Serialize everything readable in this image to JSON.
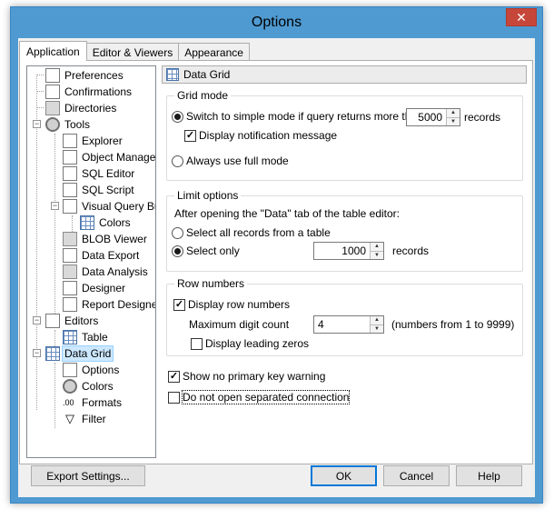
{
  "window": {
    "title": "Options",
    "close_glyph": "✕"
  },
  "tabs": [
    {
      "label": "Application",
      "active": true
    },
    {
      "label": "Editor & Viewers",
      "active": false
    },
    {
      "label": "Appearance",
      "active": false
    }
  ],
  "tree": {
    "items": [
      {
        "label": "Preferences",
        "icon": "preferences-icon"
      },
      {
        "label": "Confirmations",
        "icon": "confirmations-icon"
      },
      {
        "label": "Directories",
        "icon": "directories-icon"
      },
      {
        "label": "Tools",
        "icon": "tools-icon"
      },
      {
        "label": "Explorer",
        "icon": "explorer-icon"
      },
      {
        "label": "Object Manager",
        "icon": "object-manager-icon"
      },
      {
        "label": "SQL Editor",
        "icon": "sql-editor-icon"
      },
      {
        "label": "SQL Script",
        "icon": "sql-script-icon"
      },
      {
        "label": "Visual Query Builder",
        "icon": "visual-query-builder-icon"
      },
      {
        "label": "Colors",
        "icon": "colors-icon"
      },
      {
        "label": "BLOB Viewer",
        "icon": "blob-viewer-icon"
      },
      {
        "label": "Data Export",
        "icon": "data-export-icon"
      },
      {
        "label": "Data Analysis",
        "icon": "data-analysis-icon"
      },
      {
        "label": "Designer",
        "icon": "designer-icon"
      },
      {
        "label": "Report Designer",
        "icon": "report-designer-icon"
      },
      {
        "label": "Editors",
        "icon": "editors-icon"
      },
      {
        "label": "Table",
        "icon": "table-icon"
      },
      {
        "label": "Data Grid",
        "icon": "data-grid-icon",
        "selected": true
      },
      {
        "label": "Options",
        "icon": "options-icon"
      },
      {
        "label": "Colors",
        "icon": "grid-colors-icon"
      },
      {
        "label": "Formats",
        "icon": "formats-icon"
      },
      {
        "label": "Filter",
        "icon": "filter-icon"
      }
    ]
  },
  "panel": {
    "title": "Data Grid",
    "grid_mode": {
      "title": "Grid mode",
      "simple_mode_label": "Switch to simple mode if query returns more than",
      "simple_mode_value": "5000",
      "records_label": "records",
      "notify_label": "Display notification message",
      "full_mode_label": "Always use full mode"
    },
    "limit_options": {
      "title": "Limit options",
      "description": "After opening the \"Data\" tab of the table editor:",
      "select_all_label": "Select all records from a table",
      "select_only_label": "Select only",
      "select_only_value": "1000",
      "records_label": "records"
    },
    "row_numbers": {
      "title": "Row numbers",
      "display_label": "Display row numbers",
      "max_digit_label": "Maximum digit count",
      "max_digit_value": "4",
      "range_hint": "(numbers from 1 to 9999)",
      "leading_zeros_label": "Display leading zeros"
    },
    "no_pk_warning_label": "Show no primary key warning",
    "no_separate_conn_label": "Do not open separated connection"
  },
  "buttons": {
    "export": "Export Settings...",
    "ok": "OK",
    "cancel": "Cancel",
    "help": "Help"
  }
}
